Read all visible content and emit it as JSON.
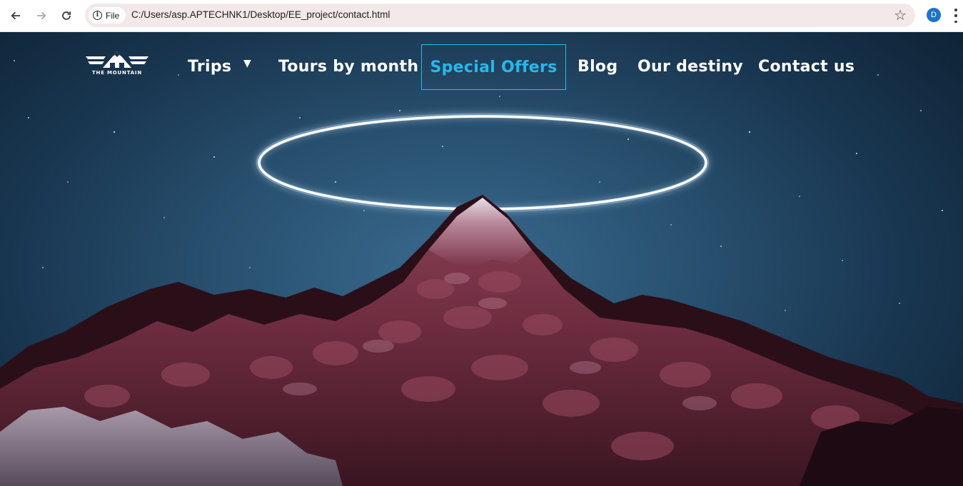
{
  "browser": {
    "back_icon": "arrow-left",
    "forward_icon": "arrow-right",
    "reload_icon": "reload",
    "site_info_label": "File",
    "url": "C:/Users/asp.APTECHNK1/Desktop/EE_project/contact.html",
    "profile_initial": "D",
    "accent": "#1a73c9"
  },
  "logo": {
    "text": "THE MOUNTAIN"
  },
  "nav": {
    "items": [
      {
        "label": "Trips",
        "has_dropdown": true
      },
      {
        "label": "Tours by month"
      },
      {
        "label": "Special Offers",
        "active": true
      },
      {
        "label": "Blog"
      },
      {
        "label": "Our destiny"
      },
      {
        "label": "Contact us"
      }
    ],
    "active_color": "#29b8ea"
  }
}
